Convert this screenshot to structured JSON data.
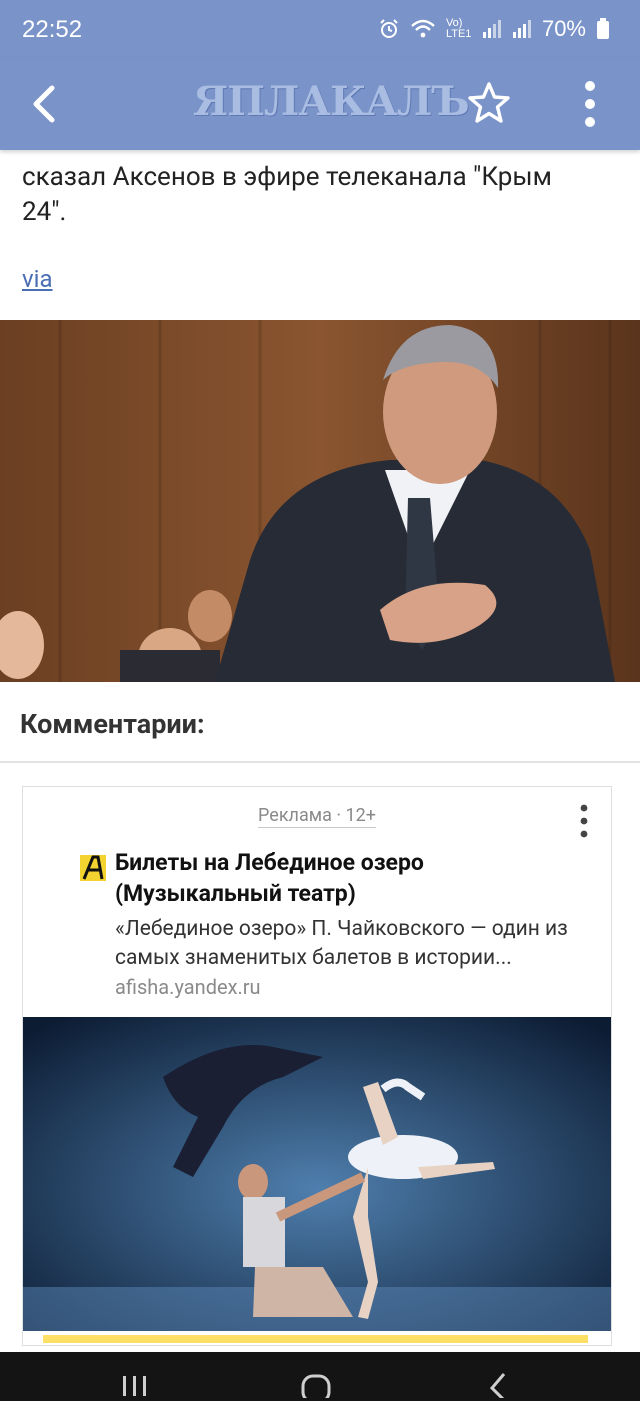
{
  "status_bar": {
    "time": "22:52",
    "network": "Vo) LTE1",
    "battery": "70%"
  },
  "app_bar": {
    "logo_text": "ЯПЛАКАЛЪ",
    "icons": [
      "chevron-left-icon",
      "star-outline-icon",
      "more-vert-icon"
    ]
  },
  "article": {
    "partial_line": "сказал Аксенов в эфире телеканала \"Крым",
    "partial_line_2": "24\".",
    "via": "via"
  },
  "comments": {
    "title": "Комментарии:"
  },
  "ad": {
    "label": "Реклама · 12+",
    "title": "Билеты на Лебединое озеро (Музыкальный театр)",
    "description": "«Лебединое озеро» П. Чайковского — один из самых знаменитых балетов в истории...",
    "domain": "afisha.yandex.ru",
    "logo_letter": "А"
  },
  "colors": {
    "app_bar_bg": "#7a93c9",
    "link": "#4a6eb3",
    "ad_logo": "#f2d330"
  }
}
